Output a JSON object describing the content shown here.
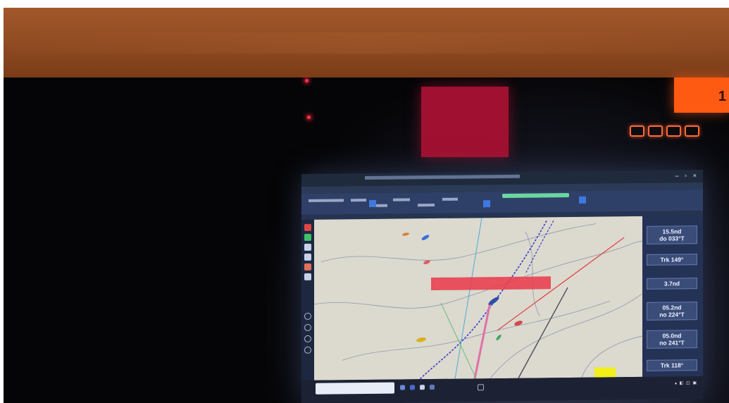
{
  "scene": {
    "orange_indicator_digit": "1",
    "hardware_buttons": 4
  },
  "monitor": {
    "window_controls": "–  ▫  ×",
    "taskbar_clock": "▴ ◧ ◫ ▣"
  },
  "side_panel": {
    "items": [
      {
        "value_line1": "15.5nd",
        "value_line2": "do 033°T"
      },
      {
        "value_line1": "Trk 149°",
        "value_line2": ""
      },
      {
        "value_line1": "3.7nd",
        "value_line2": ""
      },
      {
        "value_line1": "05.2nd",
        "value_line2": "no 224°T"
      },
      {
        "value_line1": "05.0nd",
        "value_line2": "no 241°T"
      },
      {
        "value_line1": "Trk 118°",
        "value_line2": ""
      }
    ]
  },
  "colors": {
    "overhead": "#9a5227",
    "red_alarm": "#a01030",
    "orange_alarm": "#ff5a12",
    "chart_paper": "#dcd9cf",
    "route": "#3a3bc8",
    "alert_bar": "#e8404f",
    "highlight": "#f2ef1a"
  }
}
